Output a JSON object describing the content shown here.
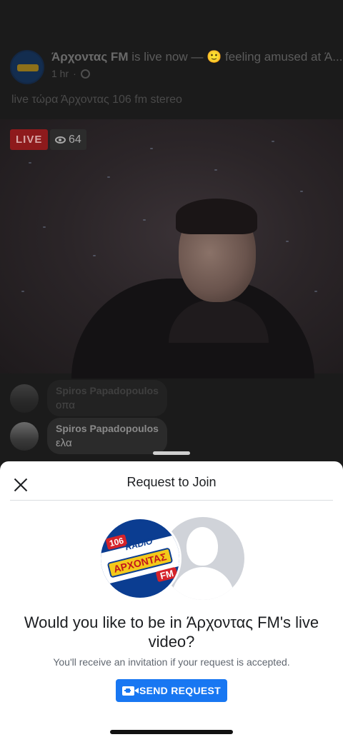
{
  "post": {
    "page_name": "Άρχοντας FM",
    "status_text": "is live now — 🙂 feeling amused at Ά...",
    "time": "1 hr",
    "separator": "·",
    "caption": "live τώρα Άρχοντας 106 fm stereo"
  },
  "video": {
    "live_label": "LIVE",
    "viewer_count": "64"
  },
  "comments": [
    {
      "name": "Spiros Papadopoulos",
      "text": "οπα"
    },
    {
      "name": "Spiros Papadopoulos",
      "text": "ελα"
    }
  ],
  "sheet": {
    "title": "Request to Join",
    "question": "Would you like to be in Άρχοντας FM's live video?",
    "subtext": "You'll receive an invitation if your request is accepted.",
    "button_label": "SEND REQUEST"
  },
  "logo": {
    "number": "106",
    "radio": "RADIO",
    "name": "ΑΡΧΟΝΤΑΣ",
    "fm": "FM"
  },
  "colors": {
    "accent": "#1877f2",
    "live": "#8e1a1c"
  }
}
